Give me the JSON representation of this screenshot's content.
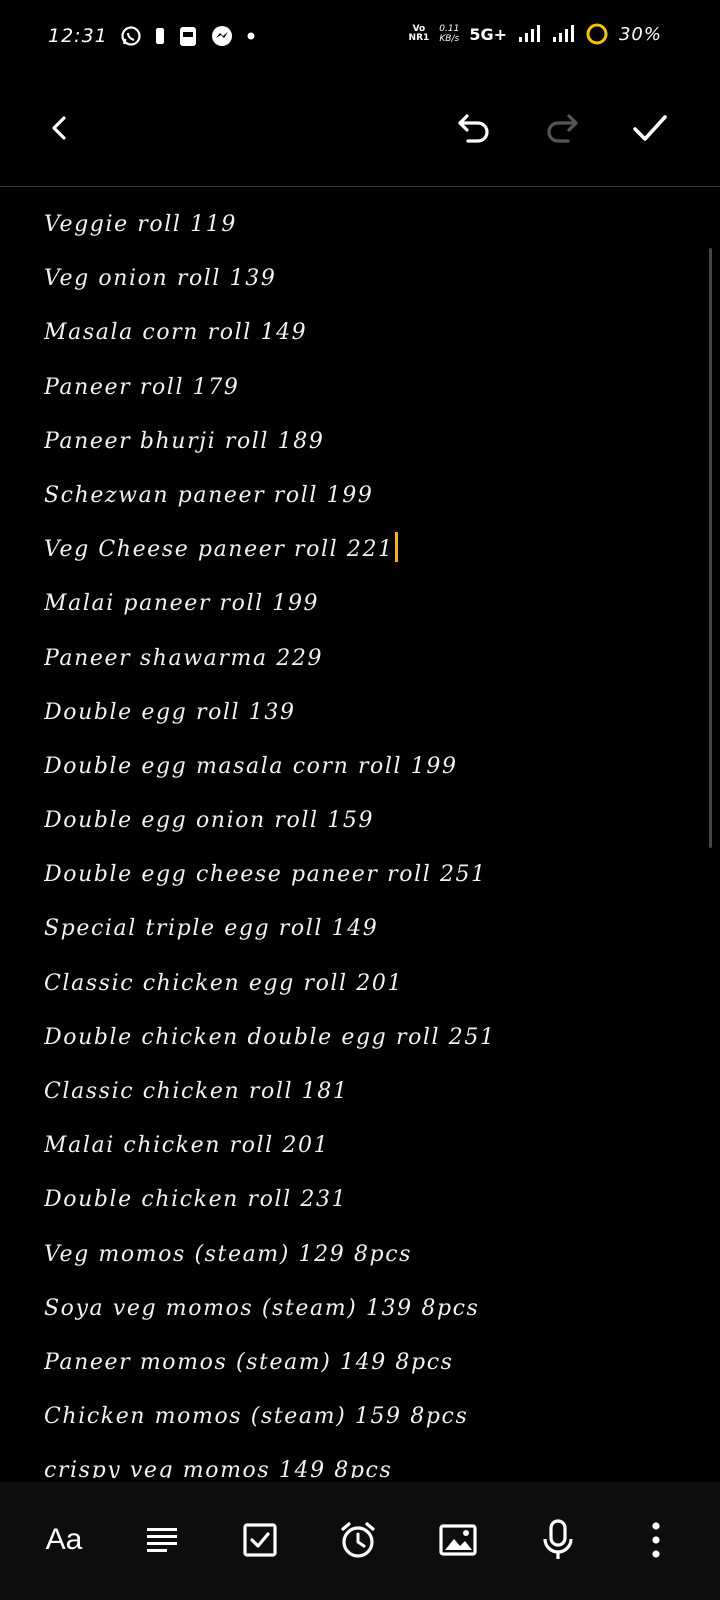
{
  "status_bar": {
    "time": "12:31",
    "volte_top": "Vo",
    "volte_bottom": "NR1",
    "speed_value": "0.11",
    "speed_unit": "KB/s",
    "network": "5G+",
    "battery_percent": "30%",
    "icons": [
      "whatsapp-icon",
      "sim-icon",
      "battery-saver-icon",
      "messenger-icon",
      "dot-icon",
      "signal-icon",
      "signal-icon-2",
      "battery-ring-icon"
    ]
  },
  "toolbar": {
    "back_icon": "chevron-left-icon",
    "undo_icon": "undo-icon",
    "redo_icon": "redo-icon",
    "done_icon": "check-icon"
  },
  "note": {
    "lines": [
      "Veggie roll 119",
      "Veg onion roll 139",
      "Masala corn roll 149",
      "Paneer roll 179",
      "Paneer bhurji roll 189",
      "Schezwan paneer roll 199",
      "Veg Cheese paneer roll 221",
      "Malai paneer roll 199",
      "Paneer shawarma 229",
      "Double egg roll 139",
      "Double egg masala corn roll 199",
      "Double egg onion roll 159",
      "Double egg cheese paneer roll 251",
      "Special triple egg roll 149",
      "Classic chicken egg roll 201",
      "Double chicken double egg roll 251",
      "Classic chicken roll 181",
      "Malai chicken roll 201",
      "Double chicken roll 231",
      "Veg momos (steam) 129 8pcs",
      "Soya veg momos (steam) 139 8pcs",
      "Paneer momos (steam) 149 8pcs",
      "Chicken momos (steam) 159 8pcs",
      "crispy veg momos 149 8pcs"
    ],
    "cursor_line": 6,
    "cursor_color": "#f5b21b"
  },
  "bottom_bar": {
    "font_label": "Aa",
    "icons": [
      "text-format-icon",
      "align-icon",
      "checkbox-icon",
      "alarm-icon",
      "image-icon",
      "microphone-icon",
      "more-vert-icon"
    ]
  }
}
